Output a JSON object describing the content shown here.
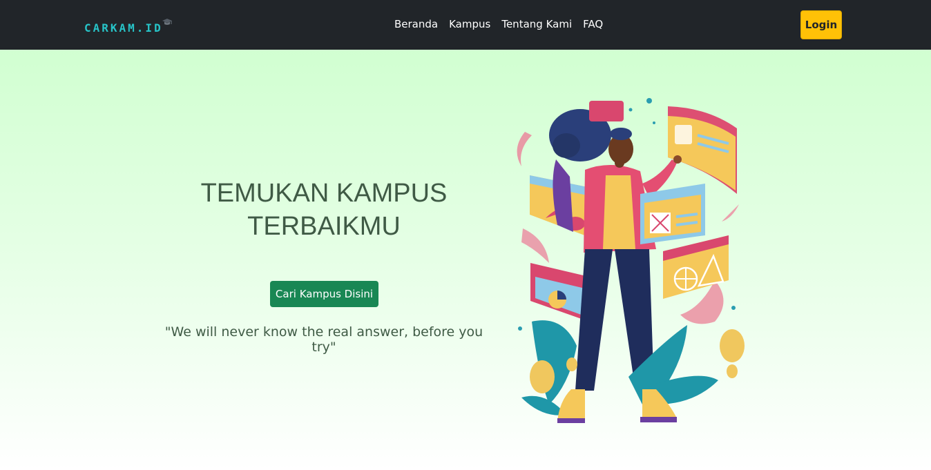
{
  "navbar": {
    "brand": "CARKAM.ID",
    "links": [
      "Beranda",
      "Kampus",
      "Tentang Kami",
      "FAQ"
    ],
    "login_label": "Login"
  },
  "hero": {
    "title_line1": "TEMUKAN KAMPUS",
    "title_line2": "TERBAIKMU",
    "cta_label": "Cari Kampus Disini",
    "quote": "\"We will never know the real answer, before you try\""
  },
  "colors": {
    "navbar_bg": "#212529",
    "brand": "#27c4c8",
    "login_bg": "#ffc107",
    "cta_bg": "#198754",
    "hero_text": "#3f5a45"
  },
  "icons": {
    "brand_mark": "graduation-cap-icon"
  }
}
